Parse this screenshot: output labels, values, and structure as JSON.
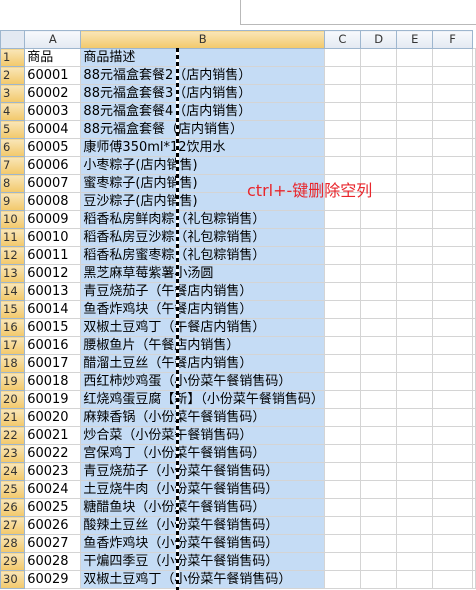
{
  "columns": [
    "A",
    "B",
    "C",
    "D",
    "E",
    "F"
  ],
  "header": [
    "商品",
    "商品描述"
  ],
  "annotation": "ctrl+-键删除空列",
  "rows": [
    {
      "n": "1",
      "a": "商品",
      "b": "商品描述"
    },
    {
      "n": "2",
      "a": "60001",
      "b": "88元福盒套餐2（店内销售）"
    },
    {
      "n": "3",
      "a": "60002",
      "b": "88元福盒套餐3（店内销售）"
    },
    {
      "n": "4",
      "a": "60003",
      "b": "88元福盒套餐4（店内销售）"
    },
    {
      "n": "5",
      "a": "60004",
      "b": "88元福盒套餐（店内销售）"
    },
    {
      "n": "6",
      "a": "60005",
      "b": "康师傅350ml*12饮用水"
    },
    {
      "n": "7",
      "a": "60006",
      "b": "小枣粽子(店内销售)"
    },
    {
      "n": "8",
      "a": "60007",
      "b": "蜜枣粽子(店内销售)"
    },
    {
      "n": "9",
      "a": "60008",
      "b": "豆沙粽子(店内销售)"
    },
    {
      "n": "10",
      "a": "60009",
      "b": "稻香私房鲜肉粽（礼包粽销售）"
    },
    {
      "n": "11",
      "a": "60010",
      "b": "稻香私房豆沙粽（礼包粽销售）"
    },
    {
      "n": "12",
      "a": "60011",
      "b": "稻香私房蜜枣粽（礼包粽销售）"
    },
    {
      "n": "13",
      "a": "60012",
      "b": "黑芝麻草莓紫薯小汤圆"
    },
    {
      "n": "14",
      "a": "60013",
      "b": "青豆烧茄子（午餐店内销售）"
    },
    {
      "n": "15",
      "a": "60014",
      "b": "鱼香炸鸡块（午餐店内销售）"
    },
    {
      "n": "16",
      "a": "60015",
      "b": "双椒土豆鸡丁（午餐店内销售）"
    },
    {
      "n": "17",
      "a": "60016",
      "b": "腰椒鱼片（午餐店内销售）"
    },
    {
      "n": "18",
      "a": "60017",
      "b": "醋溜土豆丝（午餐店内销售）"
    },
    {
      "n": "19",
      "a": "60018",
      "b": "西红柿炒鸡蛋（小份菜午餐销售码）"
    },
    {
      "n": "20",
      "a": "60019",
      "b": "红烧鸡蛋豆腐【新】（小份菜午餐销售码）"
    },
    {
      "n": "21",
      "a": "60020",
      "b": "麻辣香锅（小份菜午餐销售码）"
    },
    {
      "n": "22",
      "a": "60021",
      "b": "炒合菜（小份菜午餐销售码）"
    },
    {
      "n": "23",
      "a": "60022",
      "b": "宫保鸡丁（小份菜午餐销售码）"
    },
    {
      "n": "24",
      "a": "60023",
      "b": "青豆烧茄子（小份菜午餐销售码）"
    },
    {
      "n": "25",
      "a": "60024",
      "b": "土豆烧牛肉（小份菜午餐销售码）"
    },
    {
      "n": "26",
      "a": "60025",
      "b": "糖醋鱼块（小份菜午餐销售码）"
    },
    {
      "n": "27",
      "a": "60026",
      "b": "酸辣土豆丝（小份菜午餐销售码）"
    },
    {
      "n": "28",
      "a": "60027",
      "b": "鱼香炸鸡块（小份菜午餐销售码）"
    },
    {
      "n": "29",
      "a": "60028",
      "b": "干煸四季豆（小份菜午餐销售码）"
    },
    {
      "n": "30",
      "a": "60029",
      "b": "双椒土豆鸡丁（小份菜午餐销售码）"
    }
  ]
}
